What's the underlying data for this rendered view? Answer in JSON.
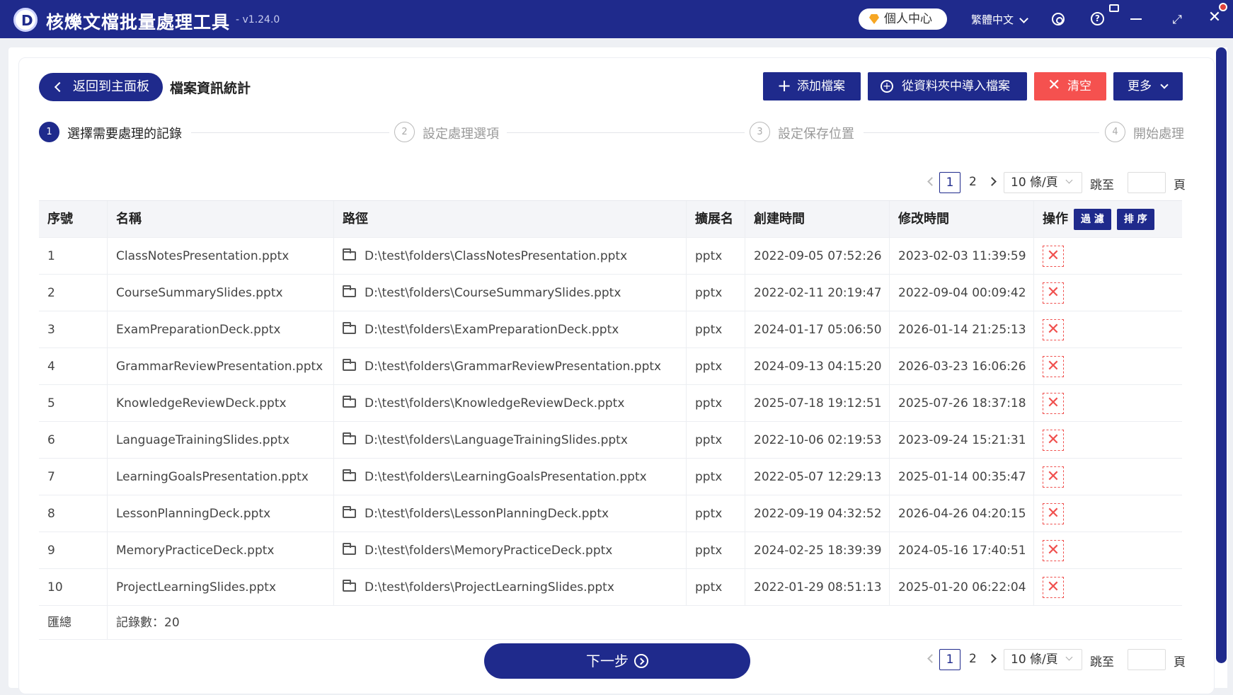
{
  "app": {
    "title": "核爍文檔批量處理工具",
    "version": "- v1.24.0",
    "personal_center": "個人中心",
    "language": "繁體中文"
  },
  "header": {
    "back_label": "返回到主面板",
    "page_title": "檔案資訊統計"
  },
  "toolbar": {
    "add_label": "添加檔案",
    "import_label": "從資料夾中導入檔案",
    "clear_label": "清空",
    "more_label": "更多"
  },
  "steps": [
    {
      "num": "1",
      "label": "選擇需要處理的記錄"
    },
    {
      "num": "2",
      "label": "設定處理選項"
    },
    {
      "num": "3",
      "label": "設定保存位置"
    },
    {
      "num": "4",
      "label": "開始處理"
    }
  ],
  "pager": {
    "page1": "1",
    "page2": "2",
    "page_size": "10 條/頁",
    "jump_label": "跳至",
    "page_label": "頁"
  },
  "table": {
    "headers": [
      "序號",
      "名稱",
      "路徑",
      "擴展名",
      "創建時間",
      "修改時間",
      "操作"
    ],
    "filter_label": "過 濾",
    "sort_label": "排 序",
    "rows": [
      {
        "idx": "1",
        "name": "ClassNotesPresentation.pptx",
        "path": "D:\\test\\folders\\ClassNotesPresentation.pptx",
        "ext": "pptx",
        "created": "2022-09-05 07:52:26",
        "modified": "2023-02-03 11:39:59"
      },
      {
        "idx": "2",
        "name": "CourseSummarySlides.pptx",
        "path": "D:\\test\\folders\\CourseSummarySlides.pptx",
        "ext": "pptx",
        "created": "2022-02-11 20:19:47",
        "modified": "2022-09-04 00:09:42"
      },
      {
        "idx": "3",
        "name": "ExamPreparationDeck.pptx",
        "path": "D:\\test\\folders\\ExamPreparationDeck.pptx",
        "ext": "pptx",
        "created": "2024-01-17 05:06:50",
        "modified": "2026-01-14 21:25:13"
      },
      {
        "idx": "4",
        "name": "GrammarReviewPresentation.pptx",
        "path": "D:\\test\\folders\\GrammarReviewPresentation.pptx",
        "ext": "pptx",
        "created": "2024-09-13 04:15:20",
        "modified": "2026-03-23 16:06:26"
      },
      {
        "idx": "5",
        "name": "KnowledgeReviewDeck.pptx",
        "path": "D:\\test\\folders\\KnowledgeReviewDeck.pptx",
        "ext": "pptx",
        "created": "2025-07-18 19:12:51",
        "modified": "2025-07-26 18:37:18"
      },
      {
        "idx": "6",
        "name": "LanguageTrainingSlides.pptx",
        "path": "D:\\test\\folders\\LanguageTrainingSlides.pptx",
        "ext": "pptx",
        "created": "2022-10-06 02:19:53",
        "modified": "2023-09-24 15:21:31"
      },
      {
        "idx": "7",
        "name": "LearningGoalsPresentation.pptx",
        "path": "D:\\test\\folders\\LearningGoalsPresentation.pptx",
        "ext": "pptx",
        "created": "2022-05-07 12:29:13",
        "modified": "2025-01-14 00:35:47"
      },
      {
        "idx": "8",
        "name": "LessonPlanningDeck.pptx",
        "path": "D:\\test\\folders\\LessonPlanningDeck.pptx",
        "ext": "pptx",
        "created": "2022-09-19 04:32:52",
        "modified": "2026-04-26 04:20:15"
      },
      {
        "idx": "9",
        "name": "MemoryPracticeDeck.pptx",
        "path": "D:\\test\\folders\\MemoryPracticeDeck.pptx",
        "ext": "pptx",
        "created": "2024-02-25 18:39:39",
        "modified": "2024-05-16 17:40:51"
      },
      {
        "idx": "10",
        "name": "ProjectLearningSlides.pptx",
        "path": "D:\\test\\folders\\ProjectLearningSlides.pptx",
        "ext": "pptx",
        "created": "2022-01-29 08:51:13",
        "modified": "2025-01-20 06:22:04"
      }
    ],
    "summary_label": "匯總",
    "summary_value": "記錄數：20"
  },
  "footer": {
    "next_label": "下一步"
  },
  "colors": {
    "primary": "#1f2a8c",
    "danger": "#f5514f"
  }
}
